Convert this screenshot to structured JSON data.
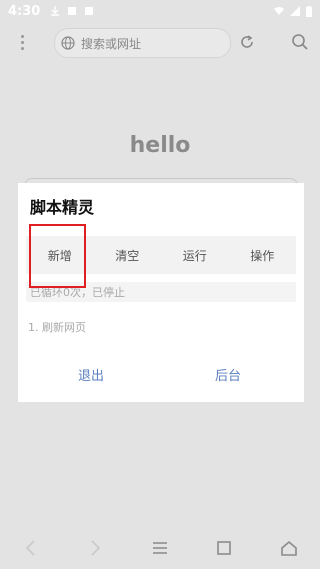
{
  "statusbar": {
    "time": "4:30"
  },
  "browser": {
    "address_placeholder": "搜索或网址"
  },
  "page": {
    "heading": "hello"
  },
  "dialog": {
    "title": "脚本精灵",
    "tabs": [
      "新增",
      "清空",
      "运行",
      "操作"
    ],
    "status": "已循环0次，已停止",
    "list": [
      "1. 刷新网页"
    ],
    "exit_label": "退出",
    "background_label": "后台"
  }
}
